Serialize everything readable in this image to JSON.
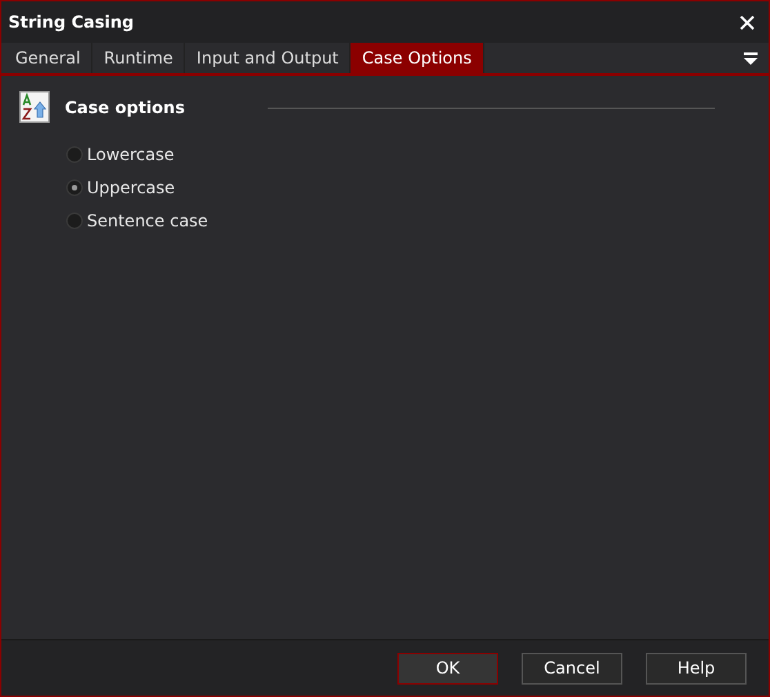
{
  "window": {
    "title": "String Casing"
  },
  "tabs": [
    {
      "label": "General",
      "selected": false
    },
    {
      "label": "Runtime",
      "selected": false
    },
    {
      "label": "Input and Output",
      "selected": false
    },
    {
      "label": "Case Options",
      "selected": true
    }
  ],
  "section": {
    "title": "Case options"
  },
  "options": [
    {
      "label": "Lowercase",
      "selected": false
    },
    {
      "label": "Uppercase",
      "selected": true
    },
    {
      "label": "Sentence case",
      "selected": false
    }
  ],
  "buttons": [
    {
      "label": "OK",
      "default": true
    },
    {
      "label": "Cancel",
      "default": false
    },
    {
      "label": "Help",
      "default": false
    }
  ]
}
